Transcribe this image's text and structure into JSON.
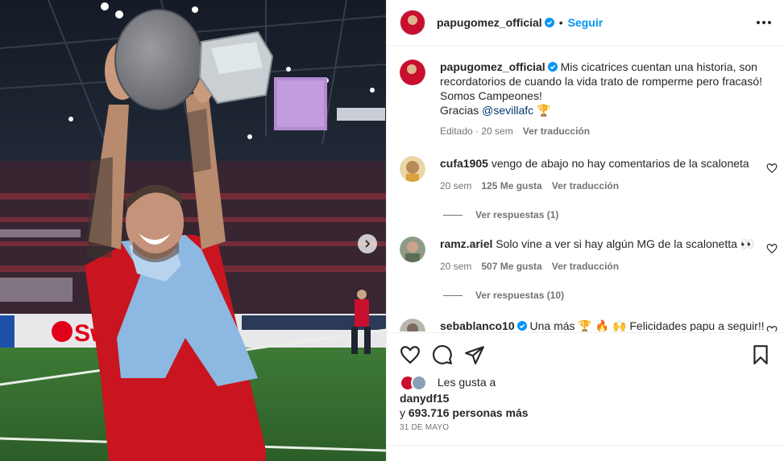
{
  "post": {
    "author": "papugomez_official",
    "follow_label": "Seguir",
    "caption_lines": [
      "Mis cicatrices cuentan una historia, son",
      "recordatorios de cuando la vida trato de romperme pero fracasó!",
      "Somos Campeones!"
    ],
    "caption_thanks": "Gracias",
    "caption_mention": "@sevillafc",
    "caption_emoji": "🏆",
    "edited_label": "Editado",
    "caption_time": "20 sem",
    "see_translation": "Ver traducción"
  },
  "comments": [
    {
      "user": "cufa1905",
      "text": "vengo de abajo no hay comentarios de la scaloneta",
      "time": "20 sem",
      "likes": "125 Me gusta",
      "translate": "Ver traducción",
      "replies": "Ver respuestas (1)"
    },
    {
      "user": "ramz.ariel",
      "text": "Solo vine a ver si hay algún MG de la scalonetta 👀",
      "time": "20 sem",
      "likes": "507 Me gusta",
      "translate": "Ver traducción",
      "replies": "Ver respuestas (10)"
    },
    {
      "user": "sebablanco10",
      "text": "Una más 🏆 🔥 🙌 Felicidades papu a seguir!!"
    }
  ],
  "likes": {
    "prefix": "Les gusta a",
    "user": "danydf15",
    "and_label": "y",
    "count": "693.716 personas más"
  },
  "date": "31 DE MAYO",
  "icons": {
    "like": "heart-icon",
    "comment": "comment-icon",
    "share": "share-icon",
    "save": "bookmark-icon",
    "more": "more-options-icon",
    "next": "chevron-right-icon",
    "verified": "verified-badge-icon"
  },
  "colors": {
    "accent": "#0095f6",
    "text": "#262626",
    "muted": "#737373",
    "verified": "#0095f6"
  }
}
